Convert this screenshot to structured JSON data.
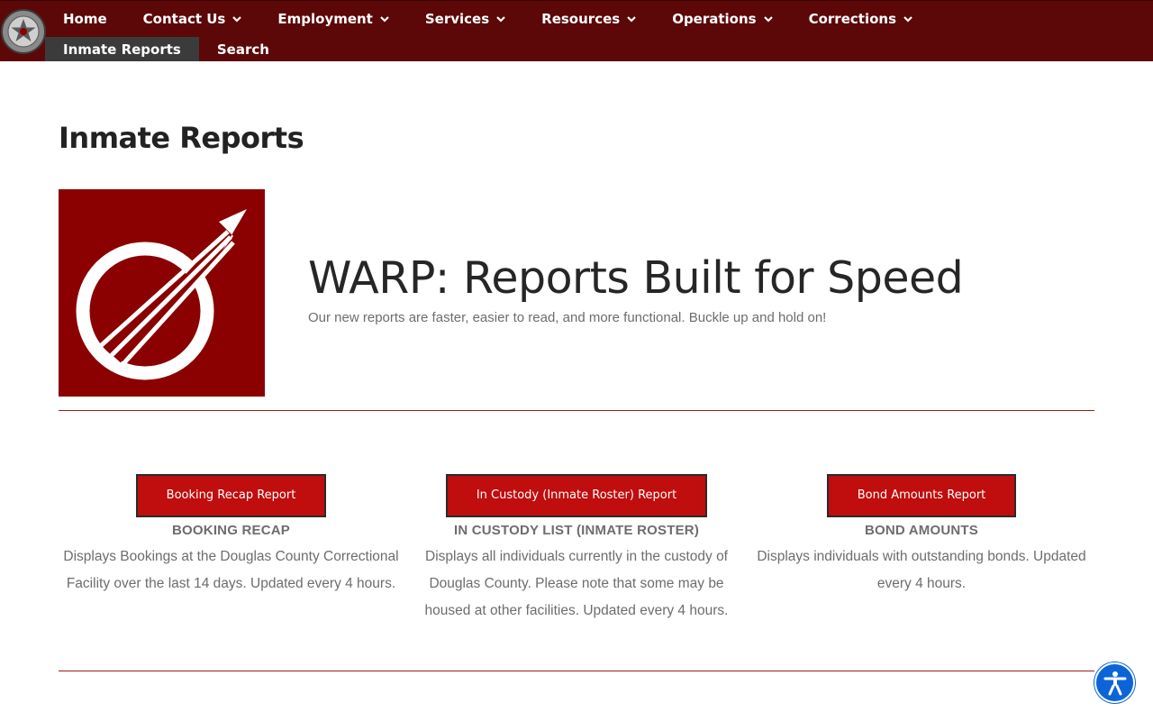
{
  "nav": {
    "items": [
      {
        "label": "Home",
        "dropdown": false
      },
      {
        "label": "Contact Us",
        "dropdown": true
      },
      {
        "label": "Employment",
        "dropdown": true
      },
      {
        "label": "Services",
        "dropdown": true
      },
      {
        "label": "Resources",
        "dropdown": true
      },
      {
        "label": "Operations",
        "dropdown": true
      },
      {
        "label": "Corrections",
        "dropdown": true
      }
    ],
    "sub_items": [
      {
        "label": "Inmate Reports",
        "active": true
      },
      {
        "label": "Search",
        "active": false
      }
    ]
  },
  "page": {
    "title": "Inmate Reports"
  },
  "warp": {
    "title": "WARP: Reports Built for Speed",
    "subtitle": "Our new reports are faster, easier to read, and more functional. Buckle up and hold on!"
  },
  "reports": [
    {
      "button": "Booking Recap Report",
      "heading": "BOOKING RECAP",
      "description": "Displays Bookings at the Douglas County Correctional Facility over the last 14 days. Updated every 4 hours."
    },
    {
      "button": "In Custody (Inmate Roster) Report",
      "heading": "IN CUSTODY LIST (INMATE ROSTER)",
      "description": "Displays all individuals currently in the custody of Douglas County. Please note that some may be housed at other facilities. Updated every 4 hours."
    },
    {
      "button": "Bond Amounts Report",
      "heading": "BOND AMOUNTS",
      "description": "Displays individuals with outstanding bonds. Updated every 4 hours."
    }
  ],
  "icons": {
    "logo": "sheriff-badge-icon",
    "warp": "rocket-arrow-icon",
    "dropdown": "chevron-down-icon",
    "accessibility": "accessibility-icon"
  },
  "colors": {
    "nav_bg": "#5c0808",
    "brand_red": "#8b0000",
    "button_red": "#c00d0d",
    "active_sub": "#3b3b3b",
    "accessibility_blue": "#0b65d8"
  }
}
